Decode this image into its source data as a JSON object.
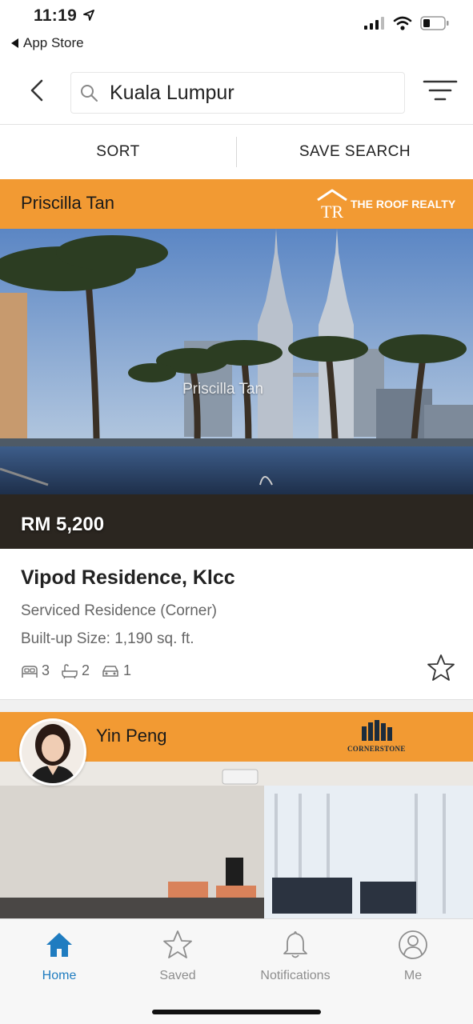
{
  "status_bar": {
    "time": "11:19",
    "back_app": "App Store"
  },
  "search": {
    "query": "Kuala Lumpur"
  },
  "actions": {
    "sort": "SORT",
    "save_search": "SAVE SEARCH"
  },
  "listings": [
    {
      "agent": "Priscilla Tan",
      "agency": "THE ROOF REALTY",
      "agency_logo_letters": "TR",
      "watermark": "Priscilla Tan",
      "price": "RM 5,200",
      "title": "Vipod Residence, Klcc",
      "type": "Serviced Residence (Corner)",
      "size": "Built-up Size: 1,190 sq. ft.",
      "bedrooms": "3",
      "bathrooms": "2",
      "parking": "1"
    },
    {
      "agent": "Yin Peng",
      "agency": "CORNERSTONE"
    }
  ],
  "tabs": [
    {
      "label": "Home",
      "icon": "home-icon",
      "active": true
    },
    {
      "label": "Saved",
      "icon": "star-icon",
      "active": false
    },
    {
      "label": "Notifications",
      "icon": "bell-icon",
      "active": false
    },
    {
      "label": "Me",
      "icon": "user-icon",
      "active": false
    }
  ],
  "colors": {
    "accent": "#f29a33",
    "active_tab": "#1f7cc0"
  }
}
